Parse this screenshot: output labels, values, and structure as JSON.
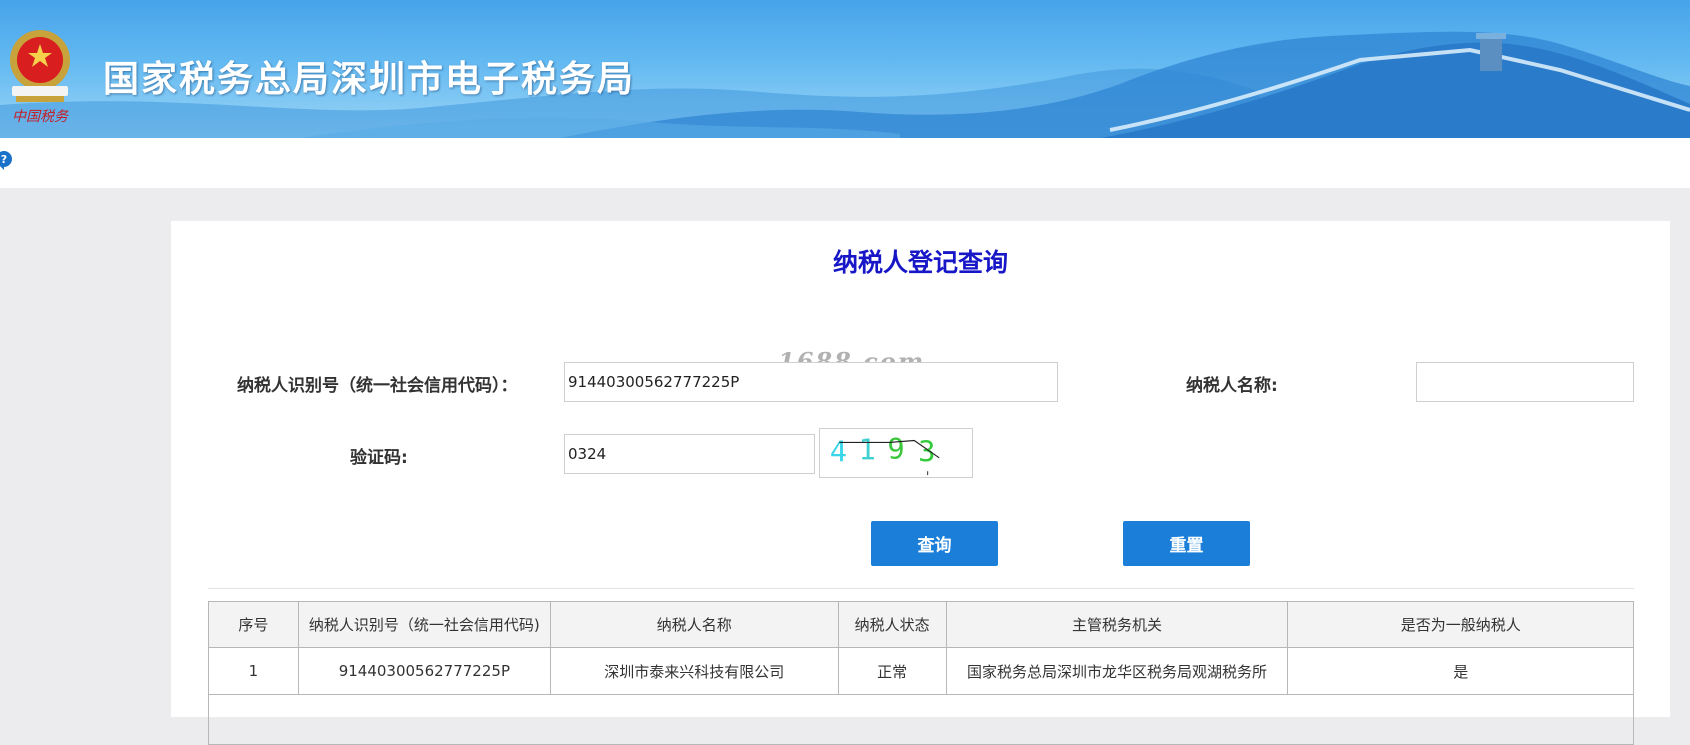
{
  "header": {
    "title": "国家税务总局深圳市电子税务局"
  },
  "icons": {
    "help": "help-pin-icon",
    "emblem": "tax-emblem-icon"
  },
  "colors": {
    "banner": "#4aa6ea",
    "title": "#1717c8",
    "button": "#1b7fd9"
  },
  "form": {
    "title": "纳税人登记查询",
    "taxpayer_id_label": "纳税人识别号（统一社会信用代码）：",
    "taxpayer_id_value": "91440300562777225P",
    "taxpayer_name_label": "纳税人名称:",
    "taxpayer_name_value": "",
    "captcha_label": "验证码:",
    "captcha_value": "0324",
    "captcha_image_text": "4193",
    "query_button": "查询",
    "reset_button": "重置"
  },
  "watermark": "1688.com",
  "table": {
    "headers": [
      "序号",
      "纳税人识别号（统一社会信用代码)",
      "纳税人名称",
      "纳税人状态",
      "主管税务机关",
      "是否为一般纳税人"
    ],
    "rows": [
      [
        "1",
        "91440300562777225P",
        "深圳市泰来兴科技有限公司",
        "正常",
        "国家税务总局深圳市龙华区税务局观湖税务所",
        "是"
      ]
    ]
  }
}
